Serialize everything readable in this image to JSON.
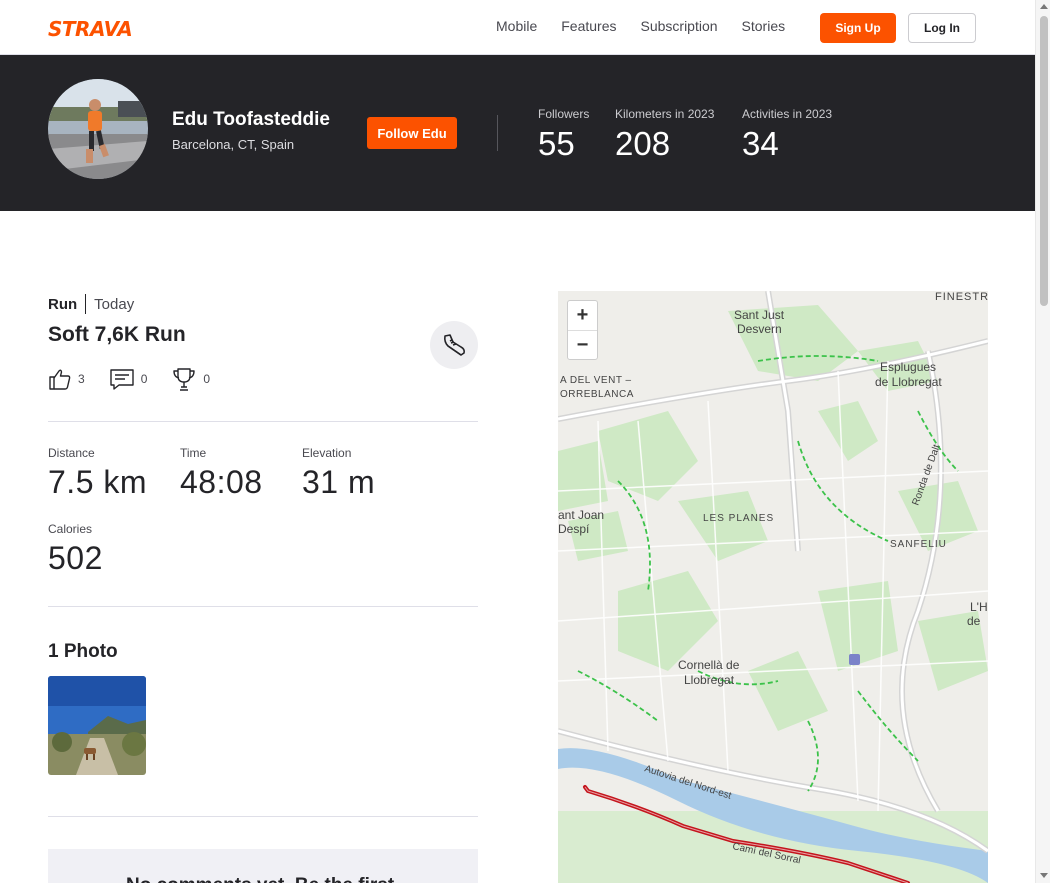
{
  "nav": {
    "logo": "STRAVA",
    "links": [
      "Mobile",
      "Features",
      "Subscription",
      "Stories"
    ],
    "signup_label": "Sign Up",
    "login_label": "Log In"
  },
  "athlete": {
    "name": "Edu Toofasteddie",
    "location": "Barcelona, CT, Spain",
    "follow_label": "Follow Edu",
    "stats": [
      {
        "label": "Followers",
        "value": "55"
      },
      {
        "label": "Kilometers in 2023",
        "value": "208"
      },
      {
        "label": "Activities in 2023",
        "value": "34"
      }
    ]
  },
  "activity": {
    "type": "Run",
    "date": "Today",
    "title": "Soft 7,6K Run",
    "kudos": "3",
    "comments": "0",
    "achievements": "0",
    "metrics": [
      {
        "label": "Distance",
        "value": "7.5 km"
      },
      {
        "label": "Time",
        "value": "48:08"
      },
      {
        "label": "Elevation",
        "value": "31 m"
      },
      {
        "label": "Calories",
        "value": "502"
      }
    ]
  },
  "photos": {
    "heading": "1 Photo"
  },
  "comments_section": {
    "empty_text": "No comments yet. Be the first"
  },
  "map": {
    "zoom_in": "+",
    "zoom_out": "−",
    "labels": [
      "FINESTR",
      "Sant Just",
      "Desvern",
      "Esplugues",
      "de Llobregat",
      "A DEL VENT –",
      "ORREBLANCA",
      "Ronda de Dalt",
      "ant Joan",
      "Despí",
      "LES PLANES",
      "SANFELIU",
      "L'H",
      "de",
      "Cornellà de",
      "Llobregat",
      "Autovia del Nord-est",
      "Camí del Sorral"
    ],
    "colors": {
      "route": "#c4141c",
      "river": "#a9cbe8",
      "parks": "#cfe9c5",
      "paths": "#3cc24a"
    }
  }
}
